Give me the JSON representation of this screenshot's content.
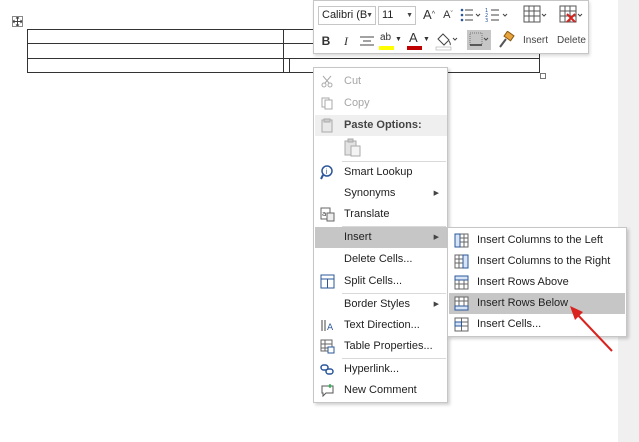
{
  "colors": {
    "accent_red": "#d9231e",
    "menu_highlight": "#c6c6c6",
    "disabled_text": "#a6a6a6",
    "font_color_bar": "#c00000",
    "highlight_bar": "#ffff00"
  },
  "mini_toolbar": {
    "font_name": "Calibri (B",
    "font_size": "11",
    "grow_font": "A",
    "shrink_font": "A",
    "bold": "B",
    "italic": "I",
    "font_color_letter": "A",
    "highlight_letters": "ab",
    "insert_label": "Insert",
    "delete_label": "Delete"
  },
  "context_menu": {
    "cut": "Cut",
    "copy": "Copy",
    "paste_options": "Paste Options:",
    "smart_lookup": "Smart Lookup",
    "synonyms": "Synonyms",
    "translate": "Translate",
    "insert": "Insert",
    "delete_cells": "Delete Cells...",
    "split_cells": "Split Cells...",
    "border_styles": "Border Styles",
    "text_direction": "Text Direction...",
    "table_properties": "Table Properties...",
    "hyperlink": "Hyperlink...",
    "new_comment": "New Comment"
  },
  "insert_submenu": {
    "cols_left": "Insert Columns to the Left",
    "cols_right": "Insert Columns to the Right",
    "rows_above": "Insert Rows Above",
    "rows_below": "Insert Rows Below",
    "cells": "Insert Cells..."
  }
}
